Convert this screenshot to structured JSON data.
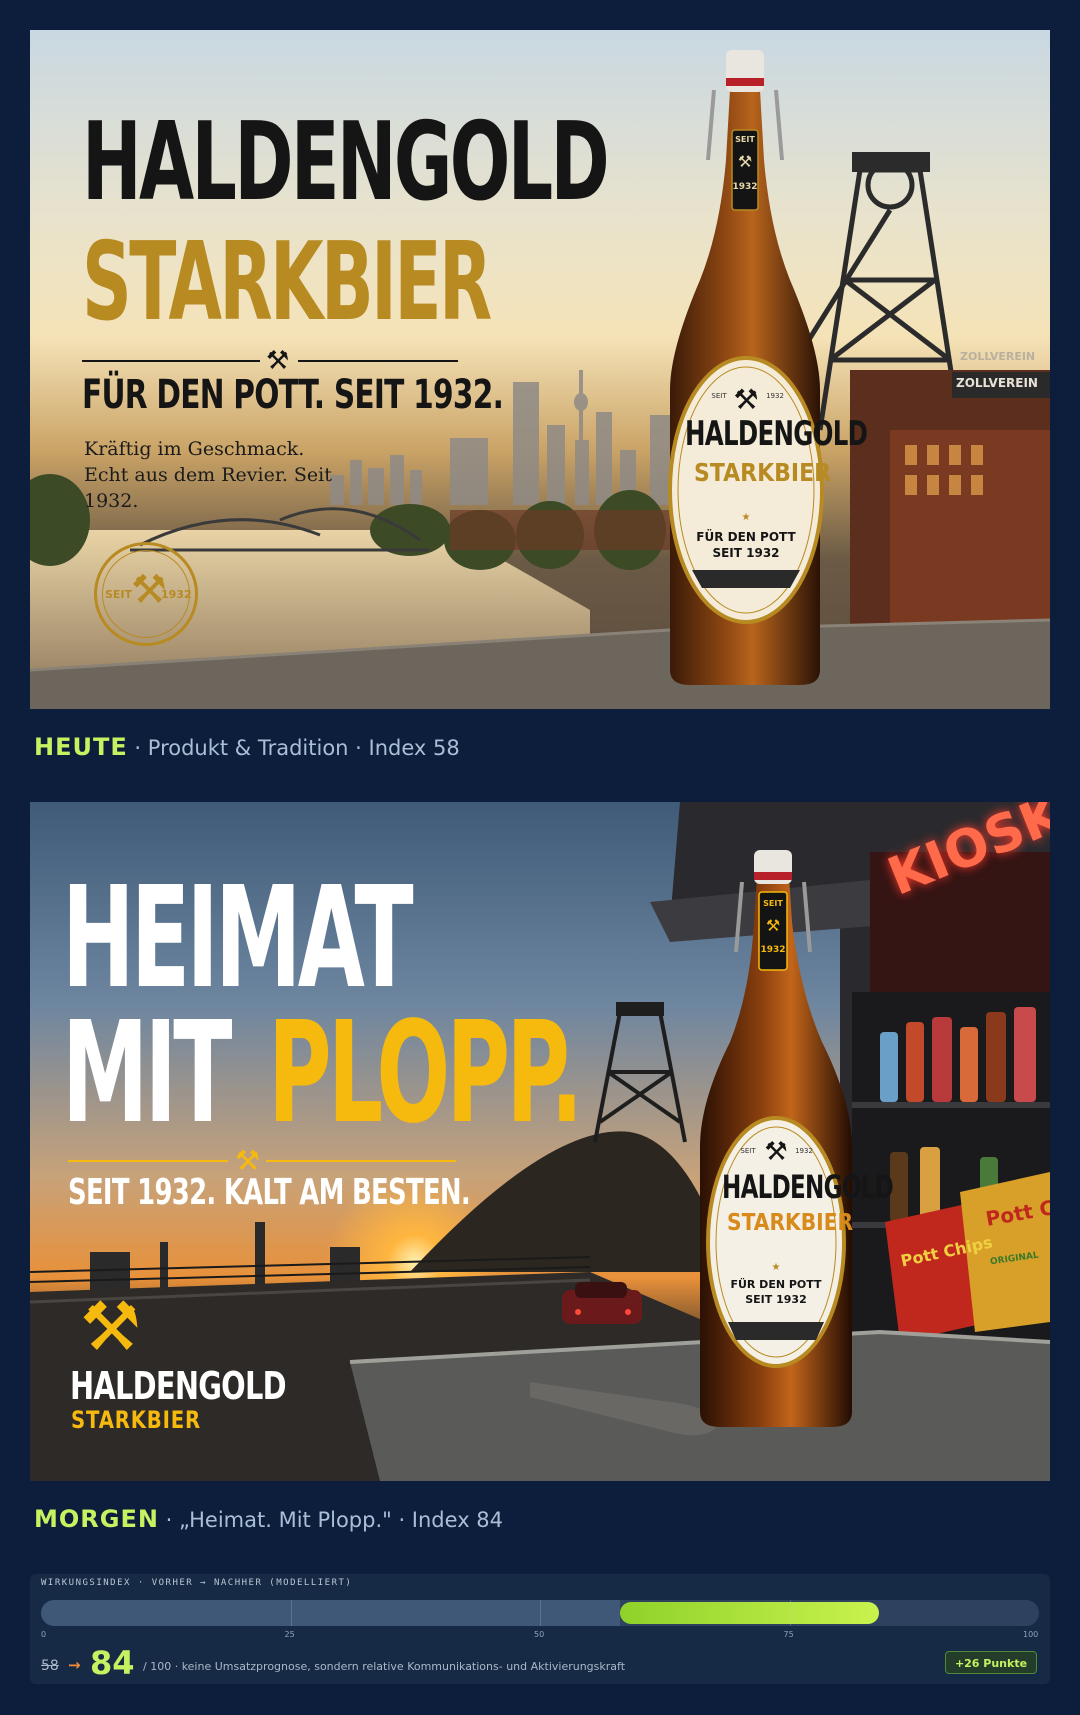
{
  "panel_today": {
    "headline_1": "HALDENGOLD",
    "headline_2": "STARKBIER",
    "tagline": "FÜR DEN POTT. SEIT 1932.",
    "subcopy": "Kräftig im Geschmack. Echt aus dem Revier. Seit 1932.",
    "seal_left": "SEIT",
    "seal_right": "1932",
    "tower_sign": "ZOLLVEREIN",
    "tower_sign_2": "ZOLLVEREIN",
    "label": {
      "neck_top": "SEIT",
      "neck_bottom": "1932",
      "seit": "SEIT",
      "year": "1932",
      "brand": "HALDENGOLD",
      "product": "STARKBIER",
      "line1": "FÜR DEN POTT",
      "line2": "SEIT 1932"
    }
  },
  "caption_today": {
    "label": "HEUTE",
    "text": "· Produkt & Tradition · Index 58"
  },
  "panel_tomorrow": {
    "headline_1": "HEIMAT",
    "headline_2": "MIT",
    "headline_3": "PLOPP.",
    "tagline": "SEIT 1932. KALT AM BESTEN.",
    "brand": "HALDENGOLD",
    "brand_sub": "STARKBIER",
    "neon": "KIOSK",
    "chips_1": "Pott Chips",
    "chips_2": "Pott Chips",
    "chips_sub": "ORIGINAL",
    "label": {
      "neck_top": "SEIT",
      "neck_bottom": "1932",
      "seit": "SEIT",
      "year": "1932",
      "brand": "HALDENGOLD",
      "product": "STARKBIER",
      "line1": "FÜR DEN POTT",
      "line2": "SEIT 1932"
    }
  },
  "caption_tomorrow": {
    "label": "MORGEN",
    "text": "· „Heimat. Mit Plopp.\" · Index 84"
  },
  "meter": {
    "title": "WIRKUNGSINDEX · VORHER → NACHHER (MODELLIERT)",
    "before": 58,
    "after": 84,
    "max": 100,
    "ticks": [
      "0",
      "25",
      "50",
      "75",
      "100"
    ],
    "before_text": "58",
    "arrow": "→",
    "after_text": "84",
    "note": "/ 100 · keine Umsatzprognose, sondern relative Kommunikations- und Aktivierungskraft",
    "badge": "+26 Punkte",
    "colors": {
      "fill": "#c6f160",
      "track": "#2e4260",
      "accent": "#f08a3a"
    }
  },
  "colors": {
    "background": "#0c1e3b",
    "gold": "#b88a22",
    "yellow": "#f6b90e",
    "lime": "#c6f160"
  }
}
